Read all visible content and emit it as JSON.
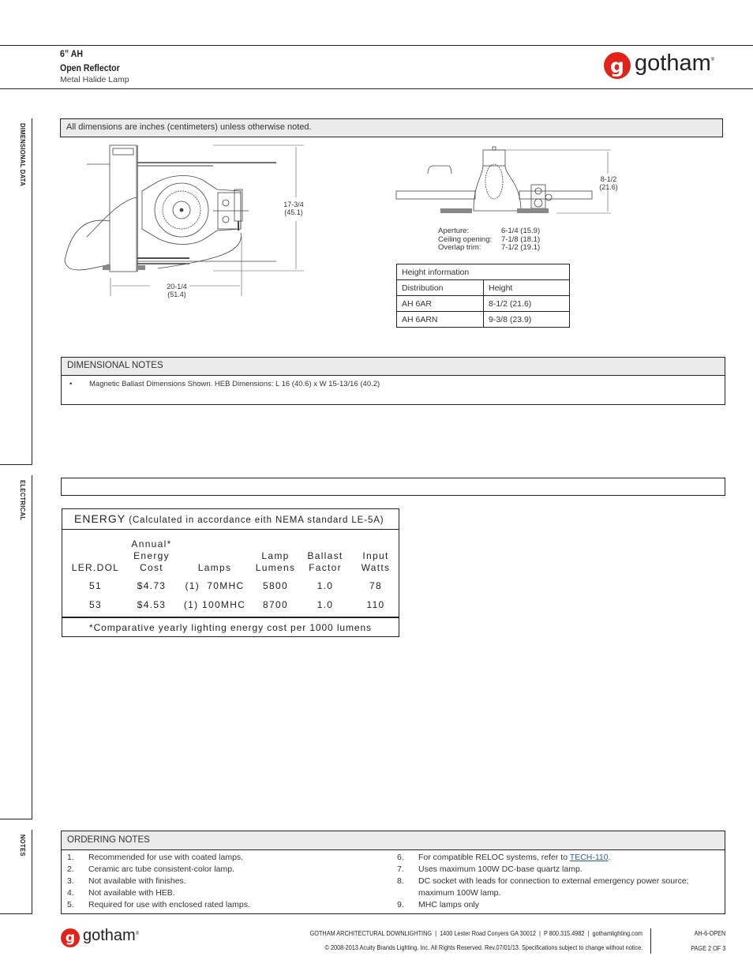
{
  "header": {
    "title": "6” AH",
    "subtitle": "Open Reflector",
    "description": "Metal Halide Lamp",
    "logo": {
      "glyph": "g",
      "wordmark": "gotham",
      "registered": "®",
      "brand_color": "#e2231a"
    }
  },
  "side_tabs": [
    {
      "label": "DIMENSIONAL DATA"
    },
    {
      "label": "ELECTRICAL"
    },
    {
      "label": "NOTES"
    }
  ],
  "dimensional": {
    "banner": "All dimensions are inches (centimeters) unless otherwise noted.",
    "plan_view": {
      "height_dim": "17-3/4",
      "height_dim_cm": "(45.1)",
      "width_dim": "20-1/4",
      "width_dim_cm": "(51.4)",
      "icon": "plan-view-drawing"
    },
    "side_view": {
      "height_dim": "8-1/2",
      "height_dim_cm": "(21.6)",
      "icon": "side-view-drawing",
      "specs": [
        {
          "label": "Aperture:",
          "value": "6-1/4 (15.9)"
        },
        {
          "label": "Ceiling opening:",
          "value": "7-1/8 (18.1)"
        },
        {
          "label": "Overlap trim:",
          "value": "7-1/2 (19.1)"
        }
      ]
    },
    "height_table": {
      "caption": "Height information",
      "headers": [
        "Distribution",
        "Height"
      ],
      "rows": [
        [
          "AH 6AR",
          "8-1/2 (21.6)"
        ],
        [
          "AH 6ARN",
          "9-3/8 (23.9)"
        ]
      ]
    },
    "notes": {
      "heading": "DIMENSIONAL NOTES",
      "bullet": "•",
      "items": [
        "Magnetic Ballast Dimensions Shown. HEB Dimensions: L 16 (40.6) x W 15-13/16 (40.2)"
      ]
    }
  },
  "electrical": {
    "banner": "",
    "energy": {
      "title_big": "ENERGY",
      "title_rest": " (Calculated in accordance eith NEMA standard  LE-5A)",
      "columns": [
        [
          "LER.DOL"
        ],
        [
          "Annual*",
          "Energy",
          "Cost"
        ],
        [
          "Lamps"
        ],
        [
          "Lamp",
          "Lumens"
        ],
        [
          "Ballast",
          "Factor"
        ],
        [
          "Input",
          "Watts"
        ]
      ],
      "rows": [
        [
          "51",
          "$4.73",
          "(1)  70MHC",
          "5800",
          "1.0",
          "78"
        ],
        [
          "53",
          "$4.53",
          "(1) 100MHC",
          "8700",
          "1.0",
          "110"
        ]
      ],
      "footnote": "*Comparative yearly lighting energy cost per 1000 lumens"
    }
  },
  "ordering_notes": {
    "heading": "ORDERING NOTES",
    "left": [
      {
        "n": "1.",
        "text": "Recommended for use with coated lamps."
      },
      {
        "n": "2.",
        "text": "Ceramic arc tube consistent-color lamp."
      },
      {
        "n": "3.",
        "text": "Not available with finishes."
      },
      {
        "n": "4.",
        "text": "Not available with HEB."
      },
      {
        "n": "5.",
        "text": "Required for use with enclosed rated lamps."
      }
    ],
    "right": [
      {
        "n": "6.",
        "text": "For compatible RELOC systems, refer to ",
        "link": "TECH-110",
        "after": "."
      },
      {
        "n": "7.",
        "text": "Uses maximum 100W DC-base quartz lamp."
      },
      {
        "n": "8.",
        "text": "DC socket with leads for connection to external emergency power source;"
      },
      {
        "n": "",
        "text": "maximum 100W lamp."
      },
      {
        "n": "9.",
        "text": "MHC lamps only"
      }
    ]
  },
  "footer": {
    "company_line": "GOTHAM ARCHITECTURAL DOWNLIGHTING  |  1400 Lester Road Conyers GA 30012  |  P 800.315.4982  |  gothamlighting.com",
    "copyright": "© 2008-2013 Acuity Brands Lighting, Inc. All Rights Reserved. Rev.07/01/13. Specifications subject to change without notice.",
    "doc_id": "AH-6-OPEN",
    "page": "PAGE 2 OF 3"
  }
}
